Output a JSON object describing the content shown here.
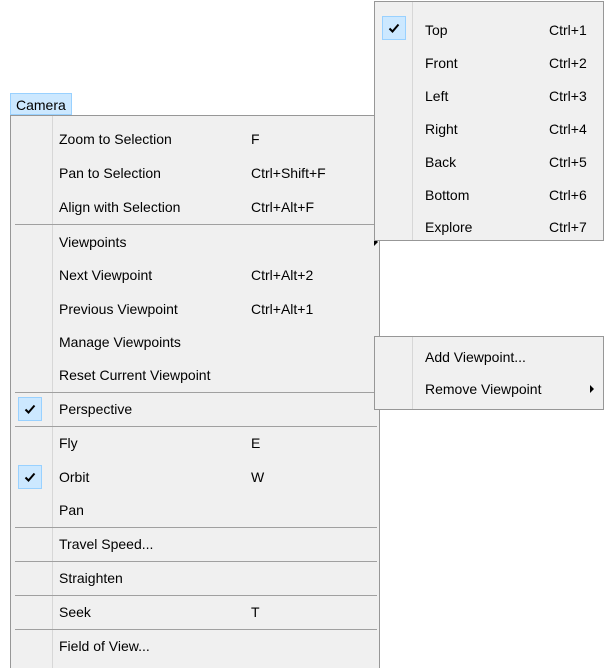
{
  "menubar": {
    "title": "Camera"
  },
  "camera_menu": {
    "items": [
      {
        "label": "Zoom to Selection",
        "shortcut": "F"
      },
      {
        "label": "Pan to Selection",
        "shortcut": "Ctrl+Shift+F"
      },
      {
        "label": "Align with Selection",
        "shortcut": "Ctrl+Alt+F"
      },
      {
        "label": "Viewpoints",
        "shortcut": ""
      },
      {
        "label": "Next Viewpoint",
        "shortcut": "Ctrl+Alt+2"
      },
      {
        "label": "Previous Viewpoint",
        "shortcut": "Ctrl+Alt+1"
      },
      {
        "label": "Manage Viewpoints",
        "shortcut": ""
      },
      {
        "label": "Reset Current Viewpoint",
        "shortcut": ""
      },
      {
        "label": "Perspective",
        "shortcut": "",
        "checked": true
      },
      {
        "label": "Fly",
        "shortcut": "E"
      },
      {
        "label": "Orbit",
        "shortcut": "W",
        "checked": true
      },
      {
        "label": "Pan",
        "shortcut": ""
      },
      {
        "label": "Travel Speed...",
        "shortcut": ""
      },
      {
        "label": "Straighten",
        "shortcut": ""
      },
      {
        "label": "Seek",
        "shortcut": "T"
      },
      {
        "label": "Field of View...",
        "shortcut": ""
      }
    ]
  },
  "viewpoints_submenu": {
    "items": [
      {
        "label": "Top",
        "shortcut": "Ctrl+1",
        "checked": true
      },
      {
        "label": "Front",
        "shortcut": "Ctrl+2"
      },
      {
        "label": "Left",
        "shortcut": "Ctrl+3"
      },
      {
        "label": "Right",
        "shortcut": "Ctrl+4"
      },
      {
        "label": "Back",
        "shortcut": "Ctrl+5"
      },
      {
        "label": "Bottom",
        "shortcut": "Ctrl+6"
      },
      {
        "label": "Explore",
        "shortcut": "Ctrl+7"
      }
    ]
  },
  "manage_submenu": {
    "items": [
      {
        "label": "Add Viewpoint..."
      },
      {
        "label": "Remove Viewpoint"
      }
    ]
  },
  "colors": {
    "highlight_fill": "#cce8ff",
    "highlight_border": "#99d1ff",
    "menu_bg": "#f0f0f0"
  },
  "icons": {
    "check": "checkmark-icon",
    "submenu": "submenu-arrow-icon"
  }
}
